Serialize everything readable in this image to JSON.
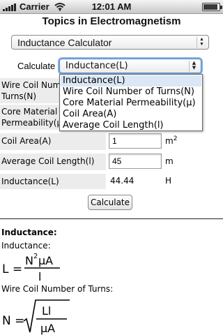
{
  "status_bar": {
    "carrier": "Carrier",
    "time": "12:01 AM",
    "battery_level": 0.9
  },
  "page": {
    "title": "Topics in Electromagnetism"
  },
  "topic_select": {
    "value": "Inductance Calculator"
  },
  "calculate": {
    "label": "Calculate",
    "selected": "Inductance(L)",
    "options": [
      "Inductance(L)",
      "Wire Coil Number of Turns(N)",
      "Core Material Permeability(μ)",
      "Coil Area(A)",
      "Average Coil Length(l)"
    ]
  },
  "form": {
    "turns": {
      "label": "Wire Coil Number of Turns(N)",
      "label_visible": "Wire Coil Num… Turns(N)"
    },
    "permeability": {
      "label": "Core Material Permeability(μ)"
    },
    "area": {
      "label": "Coil Area(A)",
      "value": "1",
      "unit": "m",
      "unit_exp": "2"
    },
    "length": {
      "label": "Average Coil Length(l)",
      "value": "45",
      "unit": "m"
    },
    "inductance": {
      "label": "Inductance(L)",
      "value": "44.44",
      "unit": "H"
    }
  },
  "button": {
    "label": "Calculate"
  },
  "results": {
    "heading": "Inductance:",
    "inductance_title": "Inductance:",
    "turns_title": "Wire Coil Number of Turns:",
    "formula_L": {
      "lhs": "L =",
      "num_N": "N",
      "num_exp": "2",
      "num_rest": "μA",
      "den": "l"
    },
    "formula_N": {
      "lhs": "N =",
      "num": "Ll",
      "den": "μA"
    }
  }
}
